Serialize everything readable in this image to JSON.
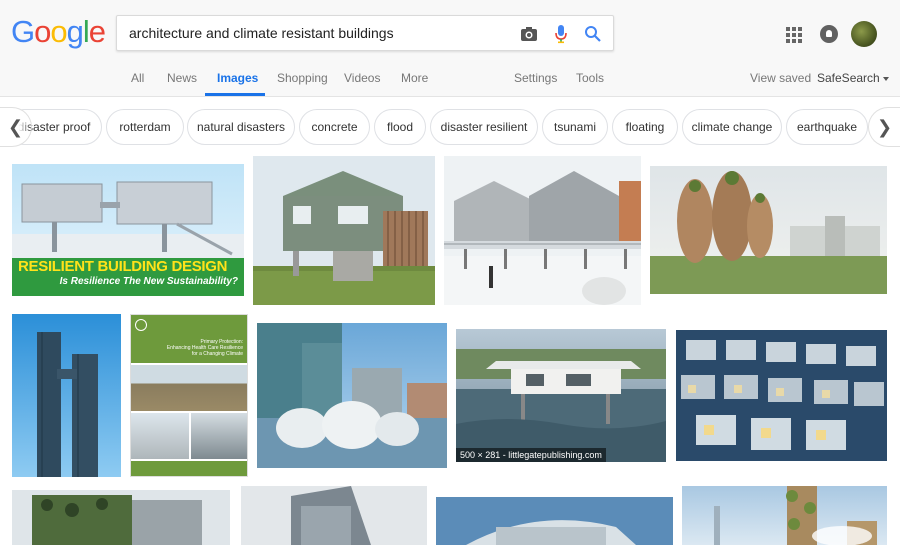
{
  "search": {
    "query": "architecture and climate resistant buildings"
  },
  "logo": {
    "letters": [
      "G",
      "o",
      "o",
      "g",
      "l",
      "e"
    ],
    "colors": [
      "#4285F4",
      "#EA4335",
      "#FBBC05",
      "#4285F4",
      "#34A853",
      "#EA4335"
    ]
  },
  "nav": {
    "all": "All",
    "news": "News",
    "images": "Images",
    "shopping": "Shopping",
    "videos": "Videos",
    "more": "More",
    "settings": "Settings",
    "tools": "Tools",
    "view_saved": "View saved",
    "safesearch": "SafeSearch"
  },
  "chips": [
    "disaster proof",
    "rotterdam",
    "natural disasters",
    "concrete",
    "flood",
    "disaster resilient",
    "tsunami",
    "floating",
    "climate change",
    "earthquake"
  ],
  "banner": {
    "title": "RESILIENT BUILDING DESIGN",
    "subtitle": "Is Resilience The New Sustainability?"
  },
  "report": {
    "line1": "Primary Protection:",
    "line2": "Enhancing Health Care Resilience",
    "line3": "for a Changing Climate"
  },
  "hover_caption": "500 × 281 - littlegatepublishing.com",
  "colors": {
    "accent": "#1a73e8",
    "header_bg": "#f8f8f8"
  }
}
